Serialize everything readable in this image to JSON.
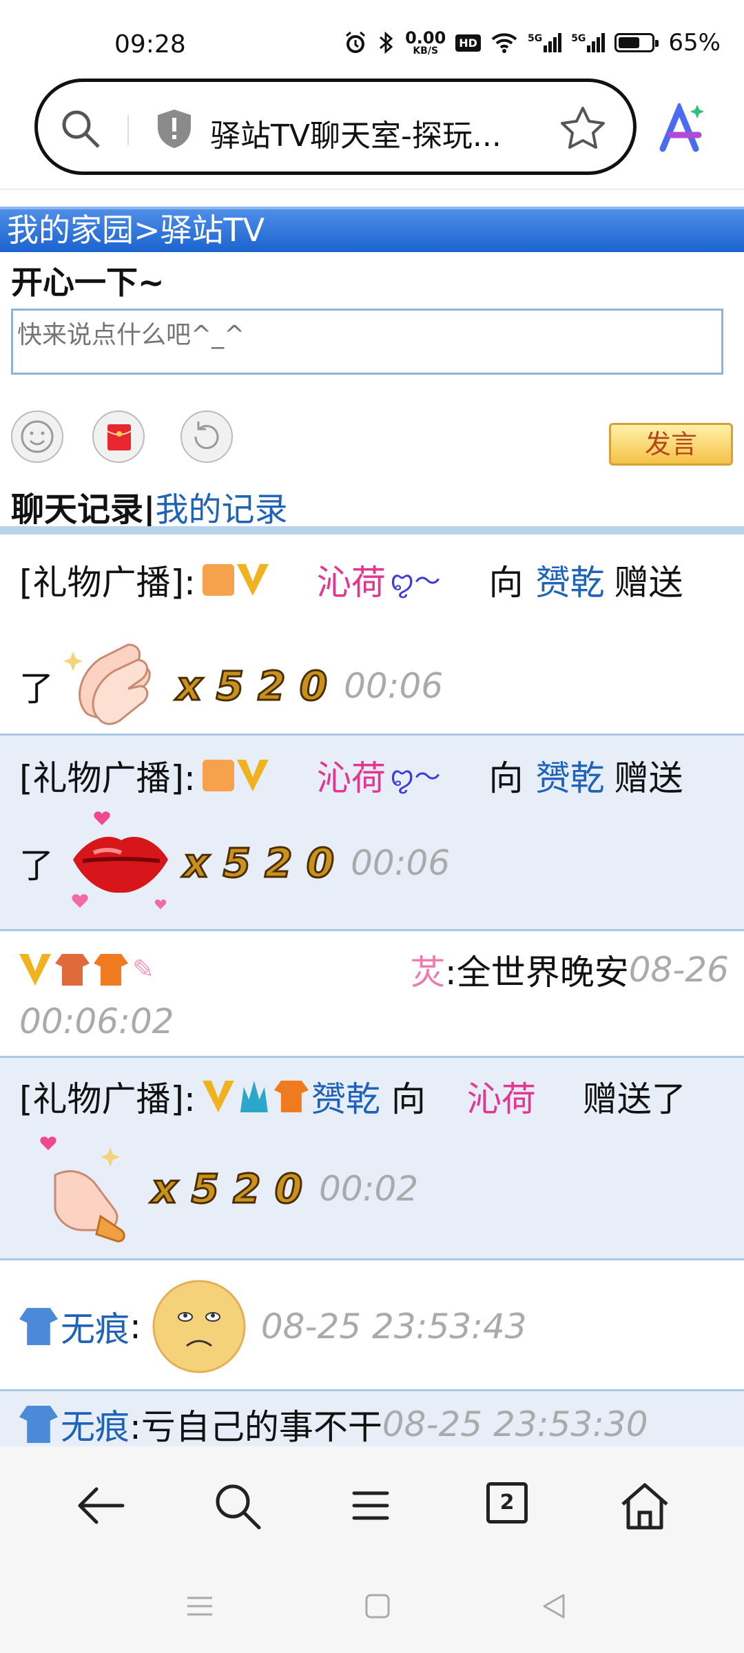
{
  "status_bar": {
    "time": "09:28",
    "net_speed": "0.00",
    "net_unit": "KB/S",
    "hd_badge": "HD",
    "signal1": "5G",
    "signal2": "5G",
    "battery_percent": "65%",
    "battery_level": 0.65,
    "icons": [
      "alarm-icon",
      "bluetooth-icon",
      "wifi-icon",
      "signal-icon",
      "battery-icon"
    ]
  },
  "address_bar": {
    "page_title": "驿站TV聊天室-探玩...",
    "icons": [
      "search-icon",
      "shield-icon",
      "star-icon",
      "ai-assistant-icon"
    ]
  },
  "breadcrumb": "我的家园>驿站TV",
  "composer": {
    "heading": "开心一下~",
    "placeholder": "快来说点什么吧^_^",
    "send_label": "发言",
    "buttons": [
      "emoji-icon",
      "red-packet-icon",
      "refresh-icon"
    ]
  },
  "tabs": {
    "chat_log": "聊天记录",
    "separator": "|",
    "my_log": "我的记录"
  },
  "messages": [
    {
      "prefix": "[礼物广播]:",
      "sender": "沁荷",
      "verb": "向",
      "receiver": "赟乾",
      "action": "赠送",
      "action2": "了",
      "gift": "clapping-hands",
      "quantity": "x 5 2 0",
      "time": "00:06"
    },
    {
      "prefix": "[礼物广播]:",
      "sender": "沁荷",
      "verb": "向",
      "receiver": "赟乾",
      "action": "赠送",
      "action2": "了",
      "gift": "red-lips",
      "quantity": "x 5 2 0",
      "time": "00:06"
    },
    {
      "sender": "炗",
      "text": ":全世界晚安",
      "date": "08-26",
      "time": "00:06:02"
    },
    {
      "prefix": "[礼物广播]:",
      "sender": "赟乾",
      "verb": "向",
      "receiver": "沁荷",
      "action": "赠送了",
      "gift": "finger-heart",
      "quantity": "x 5 2 0",
      "time": "00:02"
    },
    {
      "sender": "无痕",
      "separator": ":",
      "emoji": "sad-face",
      "time": "08-25 23:53:43"
    },
    {
      "sender": "无痕",
      "text": ":亏自己的事不干",
      "time": "08-25 23:53:30"
    }
  ],
  "bottom_nav": {
    "tab_count": "2",
    "icons": [
      "back-icon",
      "search-icon",
      "menu-icon",
      "tabs-icon",
      "home-icon"
    ]
  },
  "system_nav": [
    "recents-icon",
    "home-square-icon",
    "back-triangle-icon"
  ],
  "colors": {
    "header_blue": "#1b63cf",
    "link_blue": "#1e63b8",
    "pink": "#e23690",
    "row_alt": "#e7eef8"
  }
}
